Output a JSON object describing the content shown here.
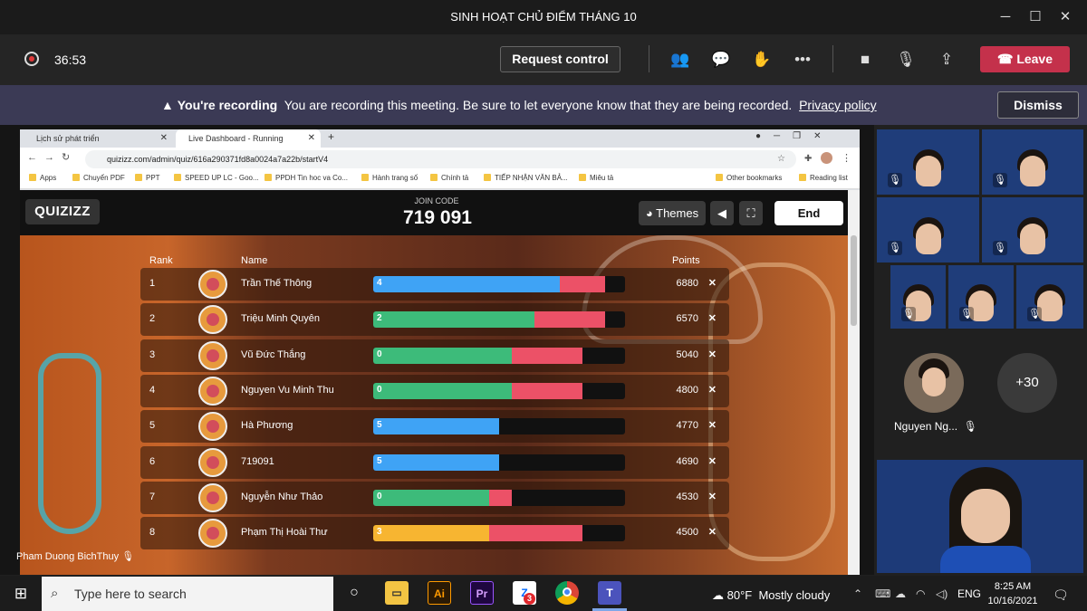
{
  "window": {
    "title": "SINH HOẠT CHỦ ĐIỂM THÁNG 10"
  },
  "meeting_toolbar": {
    "timer": "36:53",
    "request_control_label": "Request control",
    "leave_label": "Leave"
  },
  "recording_banner": {
    "title": "You're recording",
    "message": "You are recording this meeting. Be sure to let everyone know that they are being recorded.",
    "link": "Privacy policy",
    "dismiss_label": "Dismiss"
  },
  "browser": {
    "tabs": [
      {
        "label": "Lịch sử phát triển"
      },
      {
        "label": "Live Dashboard - Running"
      }
    ],
    "url": "quizizz.com/admin/quiz/616a290371fd8a0024a7a22b/startV4",
    "bookmarks": [
      "Apps",
      "Chuyển PDF",
      "PPT",
      "SPEED UP LC - Goo...",
      "PPDH Tin hoc va Co...",
      "Hành trang số",
      "Chính tả",
      "TIẾP NHẬN VĂN BẢ...",
      "Miêu tả",
      "Other bookmarks",
      "Reading list"
    ]
  },
  "quiz": {
    "logo": "QUIZIZZ",
    "join_code_label": "JOIN CODE",
    "join_code": "719 091",
    "themes_label": "Themes",
    "end_label": "End",
    "headers": {
      "rank": "Rank",
      "name": "Name",
      "points": "Points"
    },
    "players": [
      {
        "rank": "1",
        "name": "Trần Thế Thông",
        "streak": "4",
        "points": "6880",
        "blue": 0.74,
        "green": 0,
        "yellow": 0,
        "red": 0.18
      },
      {
        "rank": "2",
        "name": "Triệu Minh Quyên",
        "streak": "2",
        "points": "6570",
        "blue": 0,
        "green": 0.64,
        "yellow": 0,
        "red": 0.28
      },
      {
        "rank": "3",
        "name": "Vũ Đức Thắng",
        "streak": "0",
        "points": "5040",
        "blue": 0,
        "green": 0.55,
        "yellow": 0,
        "red": 0.28
      },
      {
        "rank": "4",
        "name": "Nguyen Vu Minh Thu",
        "streak": "0",
        "points": "4800",
        "blue": 0,
        "green": 0.55,
        "yellow": 0,
        "red": 0.28
      },
      {
        "rank": "5",
        "name": "Hà Phương",
        "streak": "5",
        "points": "4770",
        "blue": 0.5,
        "green": 0,
        "yellow": 0,
        "red": 0
      },
      {
        "rank": "6",
        "name": "719091",
        "streak": "5",
        "points": "4690",
        "blue": 0.5,
        "green": 0,
        "yellow": 0,
        "red": 0
      },
      {
        "rank": "7",
        "name": "Nguyễn Như Thảo",
        "streak": "0",
        "points": "4530",
        "blue": 0,
        "green": 0.46,
        "yellow": 0,
        "red": 0.09
      },
      {
        "rank": "8",
        "name": "Phạm Thị Hoài Thư",
        "streak": "3",
        "points": "4500",
        "blue": 0,
        "green": 0,
        "yellow": 0.46,
        "red": 0.37
      }
    ]
  },
  "presenter": {
    "name": "Pham Duong BichThuy"
  },
  "participants": {
    "featured_name": "Nguyen Ng...",
    "more_count": "+30"
  },
  "taskbar": {
    "search_placeholder": "Type here to search",
    "zalo_badge": "3",
    "weather_temp": "80°F",
    "weather_desc": "Mostly cloudy",
    "lang": "ENG",
    "time": "8:25 AM",
    "date": "10/16/2021"
  },
  "colors": {
    "leave": "#c4314b",
    "banner": "#3b3a55",
    "bar_blue": "#3fa3f5",
    "bar_green": "#3dbb7a",
    "bar_yellow": "#f7b531",
    "bar_red": "#ec5167"
  }
}
